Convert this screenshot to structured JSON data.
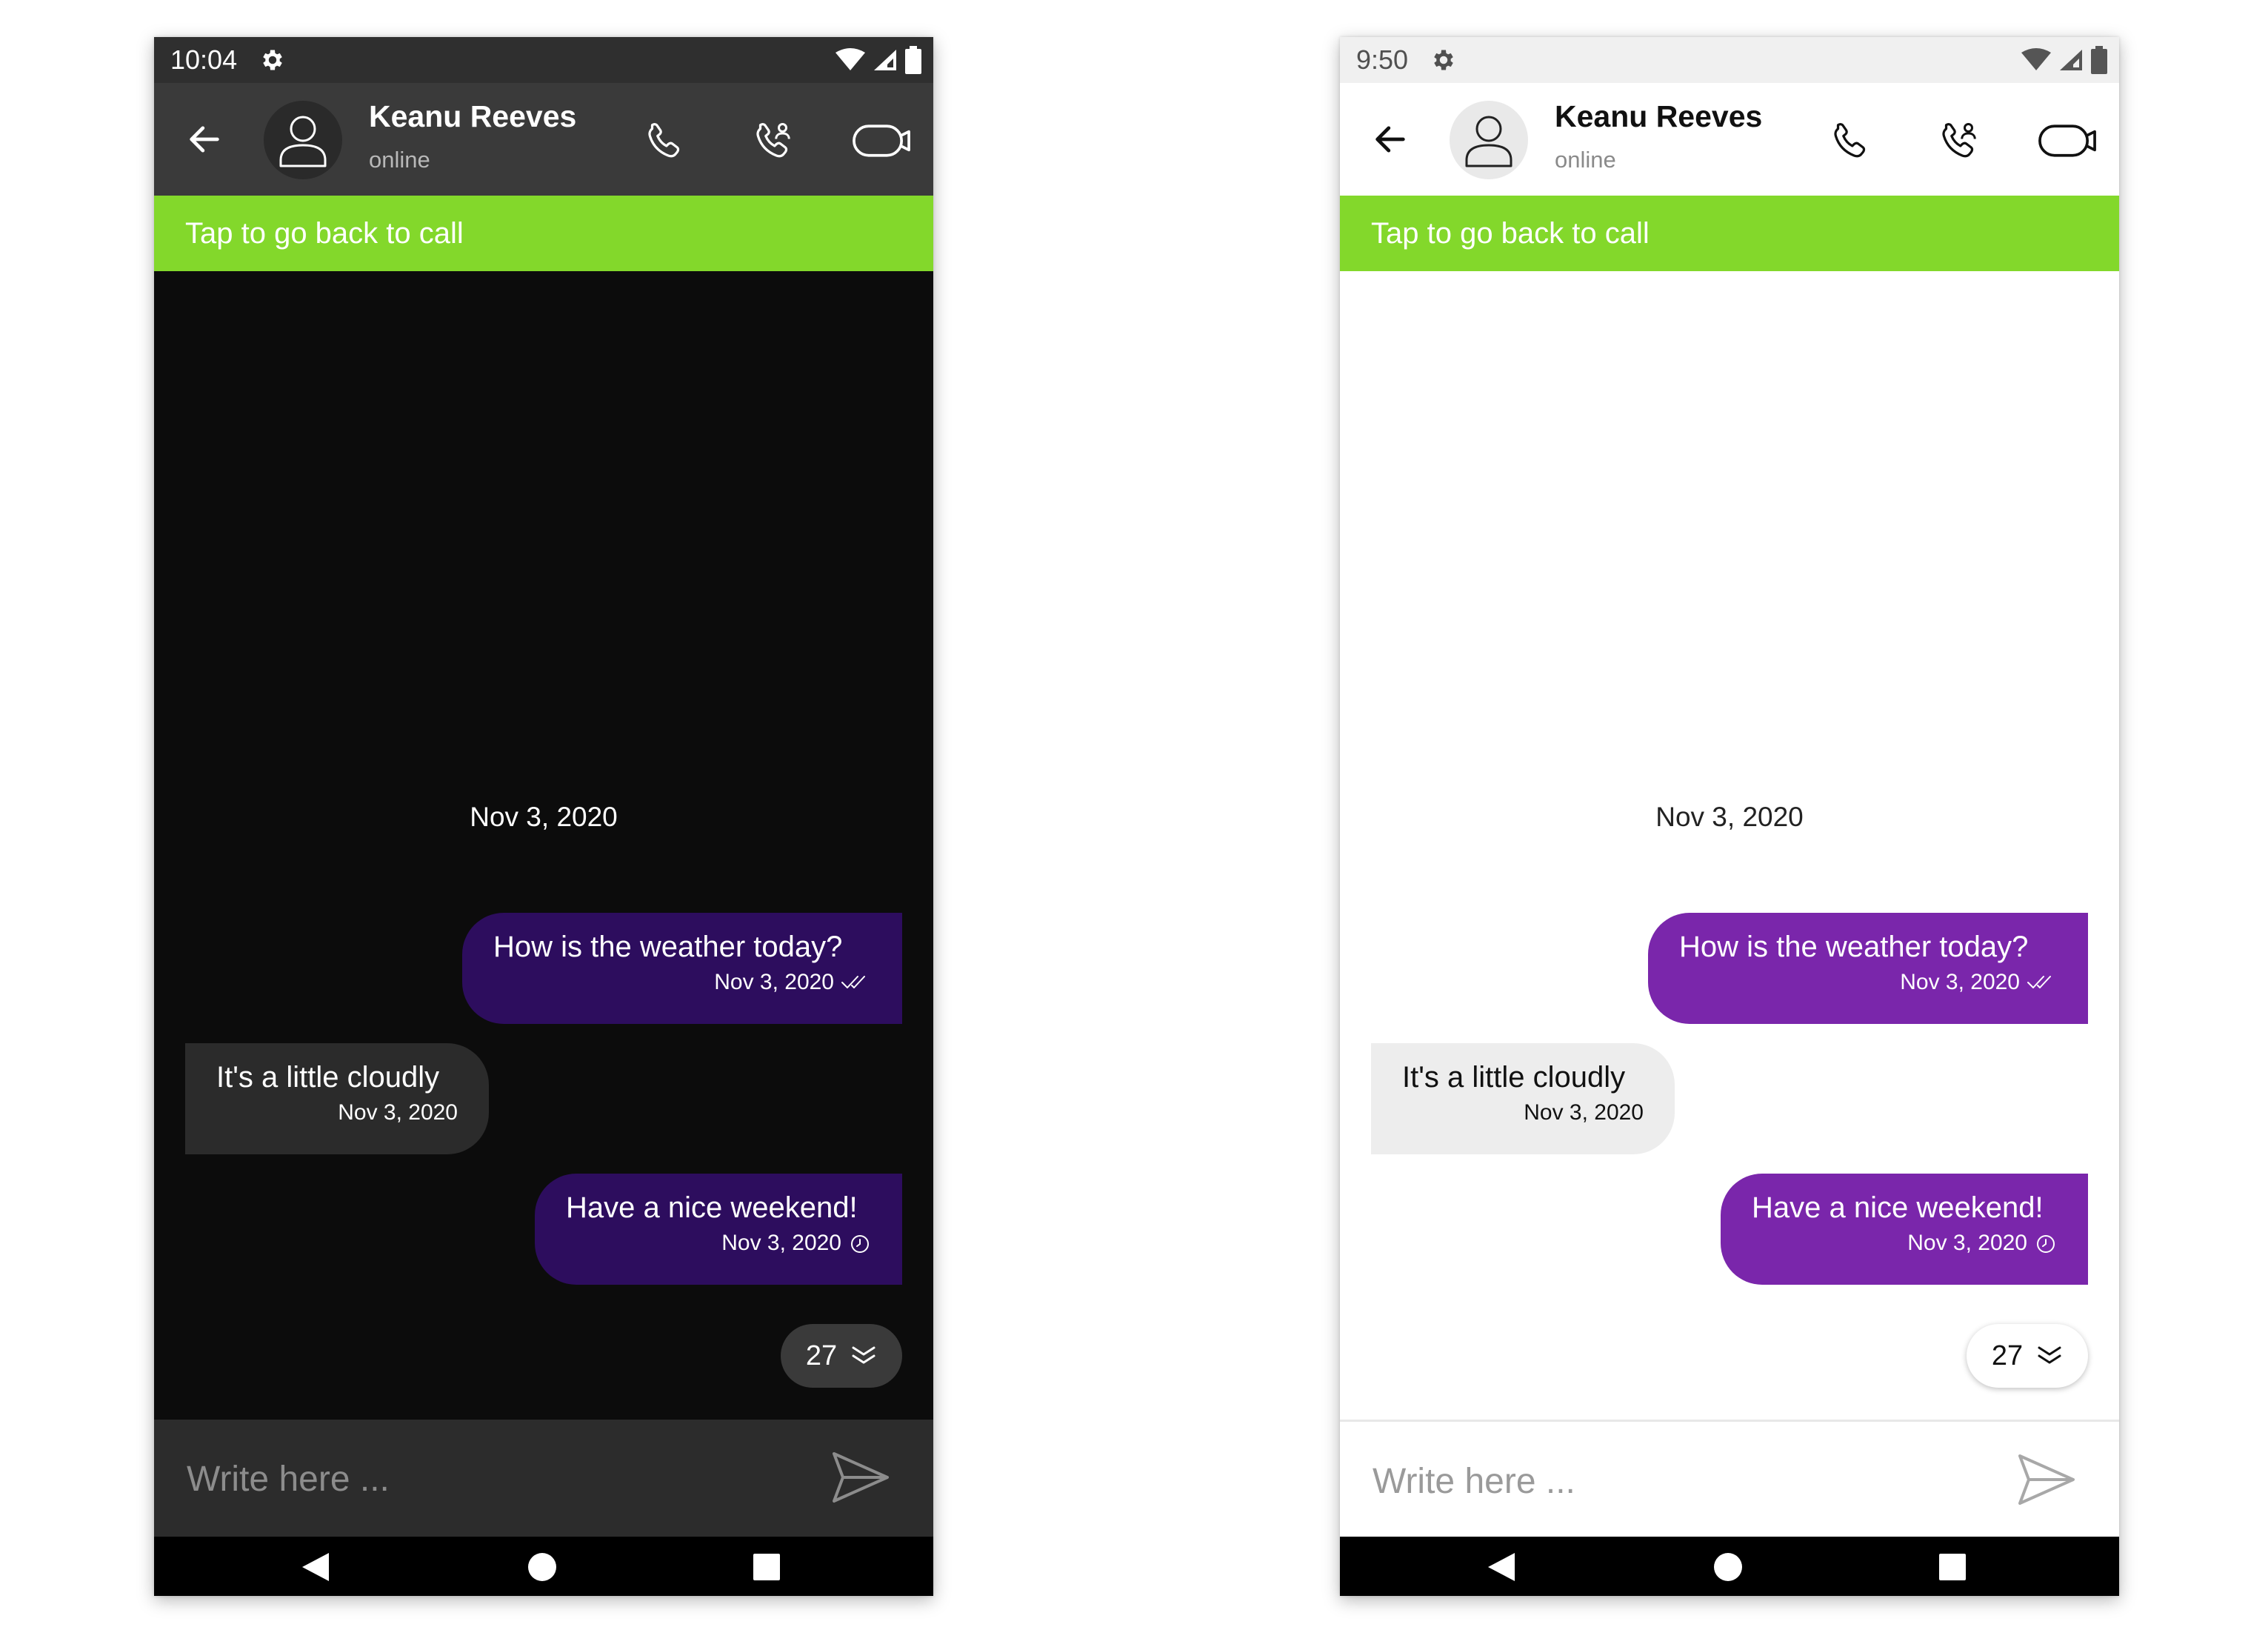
{
  "screens": [
    {
      "theme": "dark",
      "status_time": "10:04",
      "contact_name": "Keanu Reeves",
      "contact_status": "online",
      "call_banner": "Tap to go back to call",
      "date_separator": "Nov 3, 2020",
      "messages": [
        {
          "direction": "outgoing",
          "text": "How is the weather today?",
          "time": "Nov 3, 2020",
          "status_icon": "double-check-icon"
        },
        {
          "direction": "incoming",
          "text": "It's a little cloudly",
          "time": "Nov 3, 2020"
        },
        {
          "direction": "outgoing",
          "text": "Have a nice weekend!",
          "time": "Nov 3, 2020",
          "status_icon": "clock-icon"
        }
      ],
      "unread_count": "27",
      "input_placeholder": "Write here ...",
      "colors": {
        "background": "#0c0c0c",
        "appbar": "#3a3a3a",
        "outgoing_bubble": "#2d0d5e",
        "incoming_bubble": "#2b2b2b",
        "call_banner": "#83d82b"
      }
    },
    {
      "theme": "light",
      "status_time": "9:50",
      "contact_name": "Keanu Reeves",
      "contact_status": "online",
      "call_banner": "Tap to go back to call",
      "date_separator": "Nov 3, 2020",
      "messages": [
        {
          "direction": "outgoing",
          "text": "How is the weather today?",
          "time": "Nov 3, 2020",
          "status_icon": "double-check-icon"
        },
        {
          "direction": "incoming",
          "text": "It's a little cloudly",
          "time": "Nov 3, 2020"
        },
        {
          "direction": "outgoing",
          "text": "Have a nice weekend!",
          "time": "Nov 3, 2020",
          "status_icon": "clock-icon"
        }
      ],
      "unread_count": "27",
      "input_placeholder": "Write here ...",
      "colors": {
        "background": "#ffffff",
        "appbar": "#ffffff",
        "outgoing_bubble": "#7a26ab",
        "incoming_bubble": "#ededed",
        "call_banner": "#83d82b"
      }
    }
  ]
}
